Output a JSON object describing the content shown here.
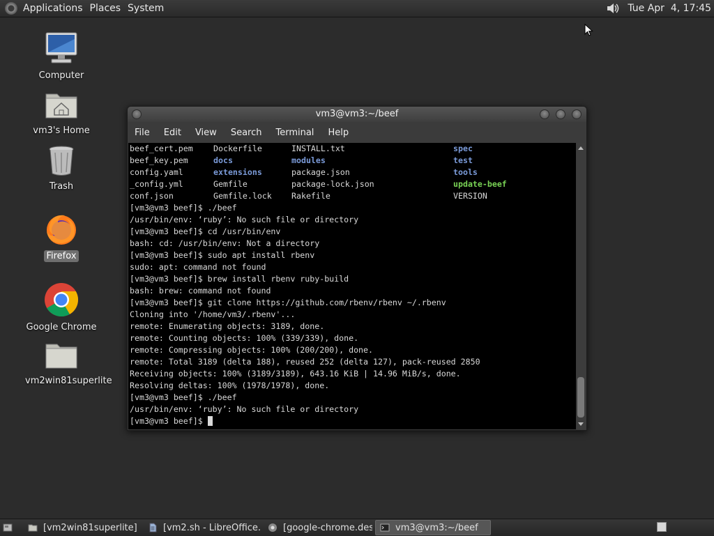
{
  "top_panel": {
    "menus": [
      "Applications",
      "Places",
      "System"
    ],
    "clock": "Tue Apr  4, 17:45"
  },
  "desktop_icons": [
    {
      "label": "Computer"
    },
    {
      "label": "vm3's Home"
    },
    {
      "label": "Trash"
    },
    {
      "label": "Firefox"
    },
    {
      "label": "Google Chrome"
    },
    {
      "label": "vm2win81superlite"
    }
  ],
  "terminal": {
    "title": "vm3@vm3:~/beef",
    "menu": [
      "File",
      "Edit",
      "View",
      "Search",
      "Terminal",
      "Help"
    ],
    "listing": [
      [
        {
          "t": "beef_cert.pem",
          "k": ""
        },
        {
          "t": "Dockerfile",
          "k": ""
        },
        {
          "t": "INSTALL.txt",
          "k": ""
        },
        {
          "t": "spec",
          "k": "dir"
        }
      ],
      [
        {
          "t": "beef_key.pem",
          "k": ""
        },
        {
          "t": "docs",
          "k": "dir"
        },
        {
          "t": "modules",
          "k": "dir"
        },
        {
          "t": "test",
          "k": "dir"
        }
      ],
      [
        {
          "t": "config.yaml",
          "k": ""
        },
        {
          "t": "extensions",
          "k": "dir"
        },
        {
          "t": "package.json",
          "k": ""
        },
        {
          "t": "tools",
          "k": "dir"
        }
      ],
      [
        {
          "t": "_config.yml",
          "k": ""
        },
        {
          "t": "Gemfile",
          "k": ""
        },
        {
          "t": "package-lock.json",
          "k": ""
        },
        {
          "t": "update-beef",
          "k": "exe"
        }
      ],
      [
        {
          "t": "conf.json",
          "k": ""
        },
        {
          "t": "Gemfile.lock",
          "k": ""
        },
        {
          "t": "Rakefile",
          "k": ""
        },
        {
          "t": "VERSION",
          "k": ""
        }
      ]
    ],
    "lines": [
      "[vm3@vm3 beef]$ ./beef",
      "/usr/bin/env: ‘ruby’: No such file or directory",
      "[vm3@vm3 beef]$ cd /usr/bin/env",
      "bash: cd: /usr/bin/env: Not a directory",
      "[vm3@vm3 beef]$ sudo apt install rbenv",
      "sudo: apt: command not found",
      "[vm3@vm3 beef]$ brew install rbenv ruby-build",
      "bash: brew: command not found",
      "[vm3@vm3 beef]$ git clone https://github.com/rbenv/rbenv ~/.rbenv",
      "Cloning into '/home/vm3/.rbenv'...",
      "remote: Enumerating objects: 3189, done.",
      "remote: Counting objects: 100% (339/339), done.",
      "remote: Compressing objects: 100% (200/200), done.",
      "remote: Total 3189 (delta 188), reused 252 (delta 127), pack-reused 2850",
      "Receiving objects: 100% (3189/3189), 643.16 KiB | 14.96 MiB/s, done.",
      "Resolving deltas: 100% (1978/1978), done.",
      "[vm3@vm3 beef]$ ./beef",
      "/usr/bin/env: ‘ruby’: No such file or directory"
    ],
    "prompt": "[vm3@vm3 beef]$ "
  },
  "taskbar": {
    "tasks": [
      {
        "label": "[vm2win81superlite]",
        "icon": "folder-icon",
        "active": false
      },
      {
        "label": "[vm2.sh - LibreOffice...",
        "icon": "document-icon",
        "active": false
      },
      {
        "label": "[google-chrome.des...",
        "icon": "chrome-icon",
        "active": false
      },
      {
        "label": "vm3@vm3:~/beef",
        "icon": "terminal-icon",
        "active": true
      }
    ]
  }
}
